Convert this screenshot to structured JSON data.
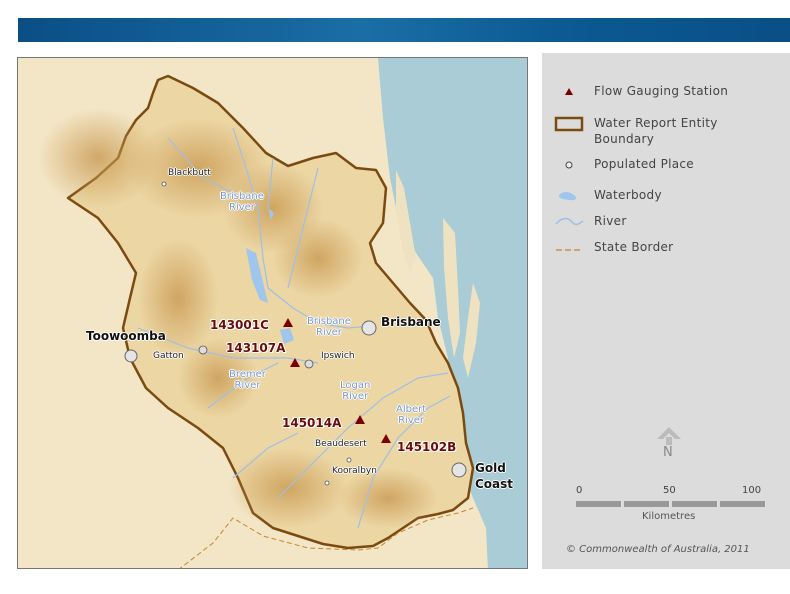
{
  "map": {
    "stations": [
      {
        "id": "143001C"
      },
      {
        "id": "143107A"
      },
      {
        "id": "145014A"
      },
      {
        "id": "145102B"
      }
    ],
    "rivers": [
      {
        "name": "Brisbane\nRiver"
      },
      {
        "name": "Brisbane\nRiver"
      },
      {
        "name": "Bremer\nRiver"
      },
      {
        "name": "Logan\nRiver"
      },
      {
        "name": "Albert\nRiver"
      }
    ],
    "places": [
      {
        "name": "Blackbutt"
      },
      {
        "name": "Gatton"
      },
      {
        "name": "Ipswich"
      },
      {
        "name": "Beaudesert"
      },
      {
        "name": "Kooralbyn"
      }
    ],
    "cities": [
      {
        "name": "Toowoomba"
      },
      {
        "name": "Brisbane"
      },
      {
        "name": "Gold\nCoast"
      }
    ]
  },
  "legend": {
    "items": [
      {
        "label": "Flow Gauging Station"
      },
      {
        "label": "Water Report Entity\nBoundary"
      },
      {
        "label": "Populated Place"
      },
      {
        "label": "Waterbody"
      },
      {
        "label": "River"
      },
      {
        "label": "State Border"
      }
    ],
    "north_label": "N",
    "scale": {
      "ticks": [
        "0",
        "50",
        "100"
      ],
      "unit": "Kilometres"
    },
    "copyright": "© Commonwealth of Australia, 2011"
  },
  "colors": {
    "terrain_light": "#f2e3c0",
    "terrain_dark": "#c99a52",
    "ocean": "#a9ccd6",
    "boundary": "#7a4a10",
    "station": "#7a0000",
    "river": "#9fbfe6",
    "header": "#0a4f86"
  }
}
